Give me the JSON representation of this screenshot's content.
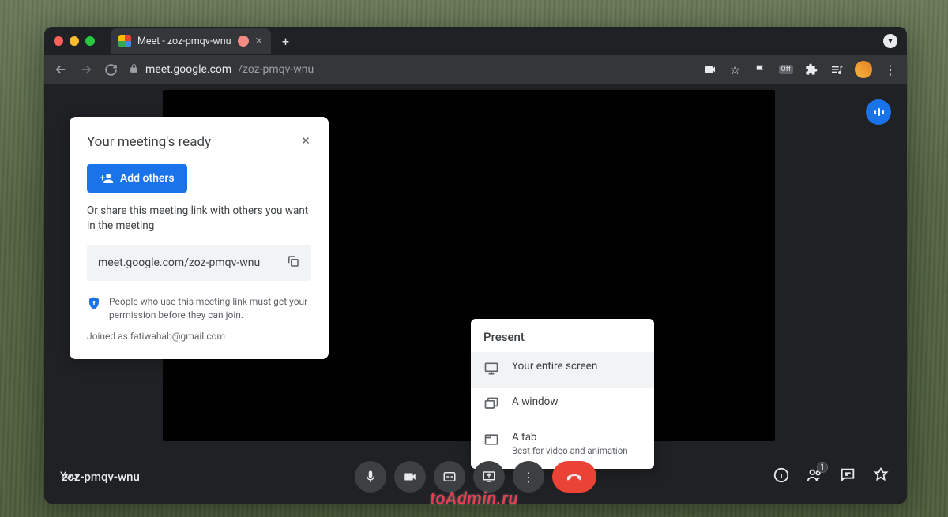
{
  "browser": {
    "tab_title": "Meet - zoz-pmqv-wnu",
    "url_host": "meet.google.com",
    "url_path": "/zoz-pmqv-wnu",
    "ext_off_label": "Off"
  },
  "meet": {
    "you_label": "You",
    "meeting_code": "zoz-pmqv-wnu",
    "participants_badge": "1"
  },
  "popup": {
    "title": "Your meeting's ready",
    "add_others": "Add others",
    "description": "Or share this meeting link with others you want in the meeting",
    "link": "meet.google.com/zoz-pmqv-wnu",
    "shield_text": "People who use this meeting link must get your permission before they can join.",
    "joined_as": "Joined as fatiwahab@gmail.com"
  },
  "present": {
    "title": "Present",
    "items": [
      {
        "label": "Your entire screen",
        "sub": ""
      },
      {
        "label": "A window",
        "sub": ""
      },
      {
        "label": "A tab",
        "sub": "Best for video and animation"
      }
    ]
  },
  "watermark": "toAdmin.ru"
}
